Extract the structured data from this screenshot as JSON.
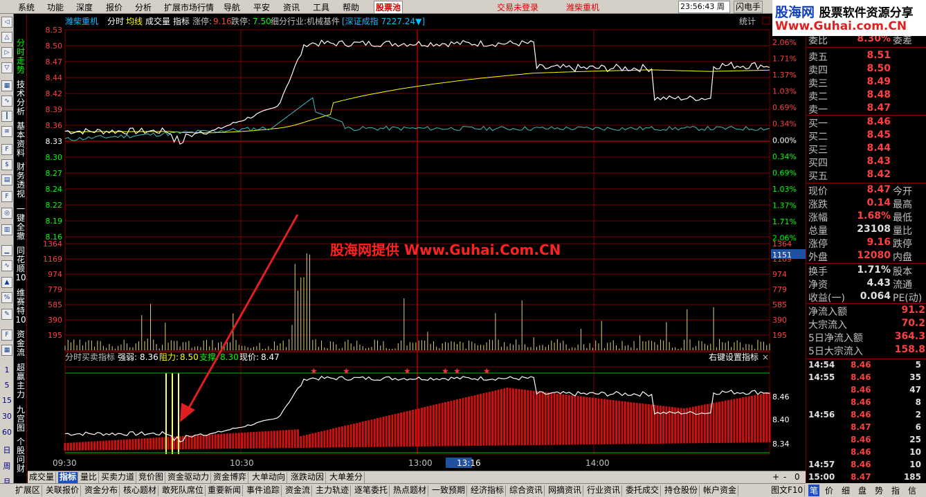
{
  "menu": [
    "系统",
    "功能",
    "深度",
    "报价",
    "分析",
    "扩展市场行情",
    "导航",
    "平安",
    "资讯",
    "工具",
    "帮助",
    "股票池"
  ],
  "menu_active_index": 11,
  "menu_notice": [
    "交易未登录",
    "潍柴重机"
  ],
  "clock": "23:56:43 周一",
  "flash_trade": "闪电手",
  "logo": {
    "brand": "股海网",
    "slogan": "股票软件资源分享",
    "url": "Www.Guhai.com.CN"
  },
  "left_numbers": [
    "1",
    "5",
    "15",
    "30",
    "60",
    "日",
    "周",
    "月"
  ],
  "left_icons": [
    "arrow-left-icon",
    "arrow-up-icon",
    "arrow-right-icon",
    "arrow-down-icon",
    "grid-icon",
    "candle-icon",
    "line-icon",
    "f10-icon",
    "tick-icon",
    "fin-icon",
    "fiz-icon",
    "zoom-icon",
    "db-icon",
    "volume-icon",
    "wave-icon",
    "pct-icon",
    "pen-icon",
    "fs-icon",
    "grid2-icon"
  ],
  "vtabs": [
    "分时走势",
    "技术分析",
    "基本资料",
    "财务透视",
    "一键全撤",
    "同花顺10",
    "维赛特10",
    "资金流",
    "超赢主力",
    "九宫图",
    "个股问财"
  ],
  "header": {
    "stock": "潍柴重机",
    "mode": "分时",
    "avg": "均线",
    "vol": "成交量",
    "ind": "指标",
    "up_label": "涨停:",
    "up_value": "9.16",
    "down_label": "跌停:",
    "down_value": "7.50",
    "industry": "细分行业:机械基件",
    "index": "[深证成指 7227.24▼]",
    "stat": "统计"
  },
  "price_axis": {
    "left": [
      "8.53",
      "8.50",
      "8.47",
      "8.44",
      "8.42",
      "8.39",
      "8.36",
      "8.33",
      "8.30",
      "8.27",
      "8.24",
      "8.22",
      "8.19",
      "8.16"
    ],
    "right": [
      "2.06%",
      "1.71%",
      "1.37%",
      "1.03%",
      "0.69%",
      "0.34%",
      "0.00%",
      "0.34%",
      "0.69%",
      "1.03%",
      "1.37%",
      "1.71%",
      "2.06%"
    ]
  },
  "volume_axis": [
    "1364",
    "1169",
    "974",
    "779",
    "585",
    "390",
    "195"
  ],
  "volume_cursor": "1151",
  "watermark": "股海网提供 Www.Guhai.Com.CN",
  "indicator": {
    "name": "分时买卖指标",
    "strong_label": "强弱:",
    "strong": "8.36",
    "resist_label": "阻力:",
    "resist": "8.50",
    "support_label": "支撑:",
    "support": "8.30",
    "now_label": "现价:",
    "now": "8.47",
    "setting": "右键设置指标",
    "close": "×",
    "axis": [
      "8.46",
      "8.40",
      "8.34"
    ]
  },
  "time_axis": [
    "09:30",
    "10:30",
    "13:00",
    "13:16",
    "14:00"
  ],
  "chart_data": {
    "type": "line",
    "series": [],
    "ylim": [
      8.13,
      8.53
    ],
    "preclose": 8.33
  },
  "quote_book": {
    "top_partial": {
      "label": "委比",
      "value": "8.30%",
      "right": "委差"
    },
    "sell": [
      {
        "label": "卖五",
        "price": "8.51"
      },
      {
        "label": "卖四",
        "price": "8.50"
      },
      {
        "label": "卖三",
        "price": "8.49"
      },
      {
        "label": "卖二",
        "price": "8.48"
      },
      {
        "label": "卖一",
        "price": "8.47"
      }
    ],
    "buy": [
      {
        "label": "买一",
        "price": "8.46"
      },
      {
        "label": "买二",
        "price": "8.45"
      },
      {
        "label": "买三",
        "price": "8.44"
      },
      {
        "label": "买四",
        "price": "8.43"
      },
      {
        "label": "买五",
        "price": "8.42"
      }
    ]
  },
  "stats": [
    {
      "l": "现价",
      "v": "8.47",
      "r": "今开",
      "c": "#ff4040"
    },
    {
      "l": "涨跌",
      "v": "0.14",
      "r": "最高",
      "c": "#ff4040"
    },
    {
      "l": "涨幅",
      "v": "1.68%",
      "r": "最低",
      "c": "#ff4040"
    },
    {
      "l": "总量",
      "v": "23108",
      "r": "量比",
      "c": "#e0e0e0"
    },
    {
      "l": "涨停",
      "v": "9.16",
      "r": "跌停",
      "c": "#ff4040"
    },
    {
      "l": "外盘",
      "v": "12080",
      "r": "内盘",
      "c": "#ff4040"
    }
  ],
  "stats2": [
    {
      "l": "换手",
      "v": "1.71%",
      "r": "股本",
      "c": "#e0e0e0"
    },
    {
      "l": "净资",
      "v": "4.43",
      "r": "流通",
      "c": "#e0e0e0"
    },
    {
      "l": "收益(一)",
      "v": "0.064",
      "r": "PE(动)",
      "c": "#e0e0e0"
    }
  ],
  "flows": [
    {
      "l": "净流入额",
      "v": "91.2"
    },
    {
      "l": "大宗流入",
      "v": "70.2"
    },
    {
      "l": "5日净流入额",
      "v": "364.3"
    },
    {
      "l": "5日大宗流入",
      "v": "158.8"
    }
  ],
  "ticks": [
    {
      "t": "14:54",
      "p": "8.46",
      "q": "5"
    },
    {
      "t": "14:55",
      "p": "8.46",
      "q": "35"
    },
    {
      "t": "",
      "p": "8.46",
      "q": "47"
    },
    {
      "t": "",
      "p": "8.46",
      "q": "8"
    },
    {
      "t": "14:56",
      "p": "8.46",
      "q": "2"
    },
    {
      "t": "",
      "p": "8.47",
      "q": "6"
    },
    {
      "t": "",
      "p": "8.46",
      "q": "25"
    },
    {
      "t": "",
      "p": "8.46",
      "q": "10"
    },
    {
      "t": "14:57",
      "p": "8.46",
      "q": "10"
    },
    {
      "t": "15:00",
      "p": "8.47",
      "q": "185"
    }
  ],
  "bottom_tabs1": [
    "成交量",
    "指标",
    "量比",
    "买卖力道",
    "竞价图",
    "资金驱动力",
    "资金博弈",
    "大单动向",
    "涨跌动因",
    "大单差分"
  ],
  "bottom_tabs1_active": 1,
  "bottom_ctrl": [
    "+",
    "-",
    "0"
  ],
  "bottom_tabs2": [
    "扩展区",
    "关联报价",
    "资金分布",
    "核心题材",
    "敢死队席位",
    "重要新闻",
    "事件追踪",
    "资金流",
    "主力轨迹",
    "逐笔委托",
    "热点题材",
    "一致预期",
    "经济指标",
    "综合资讯",
    "网摘资讯",
    "行业资讯",
    "委托成交",
    "持仓股份",
    "帐户资金",
    "图文F10"
  ],
  "right_tabs": [
    "笔",
    "价",
    "细",
    "盘",
    "势",
    "指",
    "信"
  ]
}
